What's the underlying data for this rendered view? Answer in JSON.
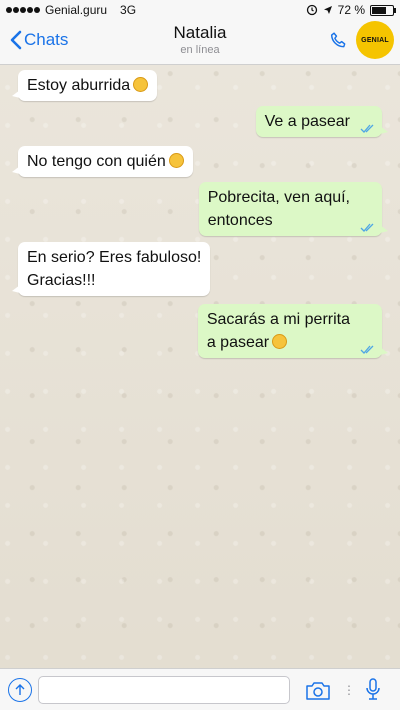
{
  "status": {
    "carrier": "Genial.guru",
    "network": "3G",
    "battery_pct": "72 %",
    "battery_level": 0.72
  },
  "header": {
    "back_label": "Chats",
    "contact_name": "Natalia",
    "presence": "en línea",
    "brand_logo_text": "GENIAL"
  },
  "messages": [
    {
      "text": "Estoy aburrida",
      "line2": "",
      "direction": "incoming",
      "emoji": "worried-face"
    },
    {
      "text": "Ve a pasear",
      "line2": "",
      "direction": "outgoing",
      "emoji": ""
    },
    {
      "text": "No tengo con quién",
      "line2": "",
      "direction": "incoming",
      "emoji": "confused-face"
    },
    {
      "text": "Pobrecita, ven aquí,",
      "line2": "entonces",
      "direction": "outgoing",
      "emoji": ""
    },
    {
      "text": "En serio? Eres fabuloso!",
      "line2": "Gracias!!!",
      "direction": "incoming",
      "emoji": ""
    },
    {
      "text": "Sacarás a mi perrita",
      "line2": "a pasear",
      "direction": "outgoing",
      "emoji": "grinning-face"
    }
  ],
  "composer": {
    "value": "",
    "placeholder": ""
  },
  "colors": {
    "accent": "#1a73e8",
    "outgoing_bubble": "#dcf8c6",
    "incoming_bubble": "#ffffff",
    "read_ticks": "#4fa6e5"
  }
}
